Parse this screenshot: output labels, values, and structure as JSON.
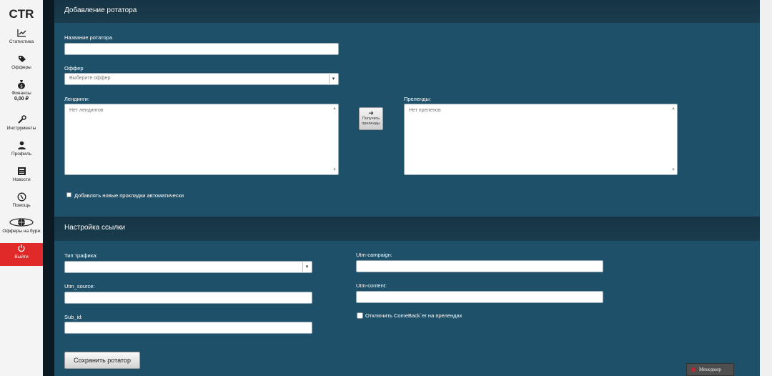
{
  "sidebar": {
    "logo": "CTR",
    "items": [
      {
        "label": "Статистика",
        "icon": "chart-icon"
      },
      {
        "label": "Офферы",
        "icon": "tag-icon"
      },
      {
        "label": "Финансы",
        "icon": "money-bag-icon",
        "balance": "0,00 ₽"
      },
      {
        "label": "Инструменты",
        "icon": "wrench-icon"
      },
      {
        "label": "Профиль",
        "icon": "user-icon"
      },
      {
        "label": "Новости",
        "icon": "newspaper-icon"
      },
      {
        "label": "Помощь",
        "icon": "help-icon"
      },
      {
        "label": "Офферы на бурж",
        "icon": "globe-icon"
      },
      {
        "label": "Выйти",
        "icon": "power-icon"
      }
    ]
  },
  "rotator": {
    "title": "Добавление ротатора",
    "name_label": "Название ротатора",
    "name_value": "",
    "offer_label": "Оффер",
    "offer_placeholder": "Выберите оффер",
    "landings_label": "Лендинги:",
    "landings_empty": "Нет лендингов",
    "get_button_line1": "Получить",
    "get_button_line2": "преленды",
    "prelands_label": "Преленды:",
    "prelands_empty": "Нет преленов",
    "auto_add_label": "Добавлять новые прокладки автоматически"
  },
  "link": {
    "title": "Настройка ссылки",
    "traffic_type_label": "Тип трафика:",
    "utm_source_label": "Utm_source:",
    "sub_id_label": "Sub_id:",
    "utm_campaign_label": "Utm-campaign:",
    "utm_content_label": "Utm-content:",
    "disable_comeback_label": "Отключить ComeBack`er на прелендах",
    "save_button": "Сохранить ротатор"
  },
  "manager": {
    "label": "Менеджер"
  },
  "colors": {
    "panel_bg": "#1e5169",
    "header_bg": "#163443",
    "exit_bg": "#e02a2a"
  }
}
